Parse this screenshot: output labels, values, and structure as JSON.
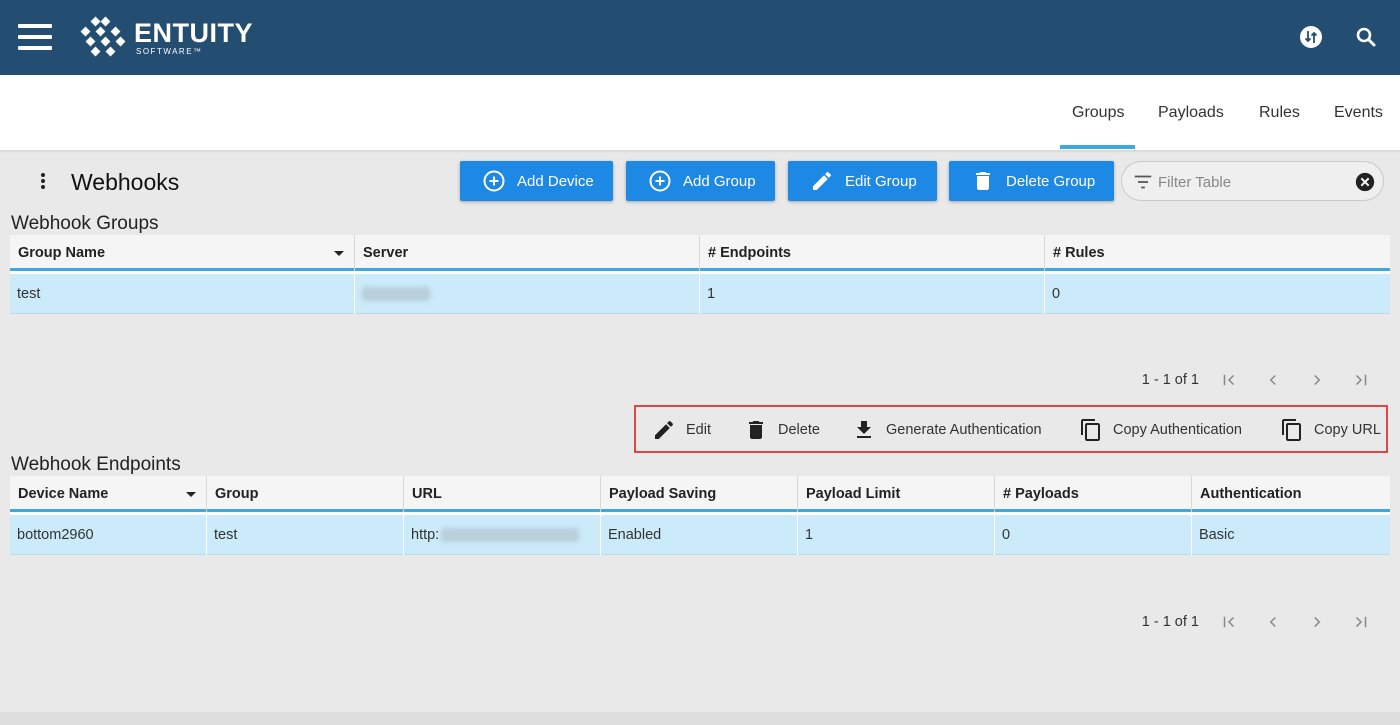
{
  "header": {
    "brand": "ENTUITY",
    "brand_sub": "SOFTWARE™",
    "bg_color": "#234e72",
    "icons": [
      "menu-icon",
      "entuity-logo",
      "sync-icon",
      "search-icon"
    ]
  },
  "tabs": [
    {
      "label": "Groups",
      "active": true
    },
    {
      "label": "Payloads",
      "active": false
    },
    {
      "label": "Rules",
      "active": false
    },
    {
      "label": "Events",
      "active": false
    }
  ],
  "page": {
    "title": "Webhooks"
  },
  "toolbar": {
    "add_device": "Add Device",
    "add_group": "Add Group",
    "edit_group": "Edit Group",
    "delete_group": "Delete Group",
    "button_color": "#1e88e5"
  },
  "filter": {
    "placeholder": "Filter Table"
  },
  "groups_table": {
    "title": "Webhook Groups",
    "columns": [
      "Group Name",
      "Server",
      "# Endpoints",
      "# Rules"
    ],
    "rows": [
      {
        "group_name": "test",
        "server": "",
        "endpoints": "1",
        "rules": "0"
      }
    ],
    "pager": {
      "range": "1 - 1 of 1"
    }
  },
  "actions": {
    "edit": "Edit",
    "delete": "Delete",
    "generate_auth": "Generate Authentication",
    "copy_auth": "Copy Authentication",
    "copy_url": "Copy URL",
    "highlight_color": "#e04646"
  },
  "endpoints_table": {
    "title": "Webhook Endpoints",
    "columns": [
      "Device Name",
      "Group",
      "URL",
      "Payload Saving",
      "Payload Limit",
      "# Payloads",
      "Authentication"
    ],
    "rows": [
      {
        "device_name": "bottom2960",
        "group": "test",
        "url": "http:",
        "payload_saving": "Enabled",
        "payload_limit": "1",
        "payloads": "0",
        "authentication": "Basic"
      }
    ],
    "pager": {
      "range": "1 - 1 of 1"
    }
  },
  "colors": {
    "accent": "#3ea9e0",
    "selected_row": "#cbeafa"
  }
}
